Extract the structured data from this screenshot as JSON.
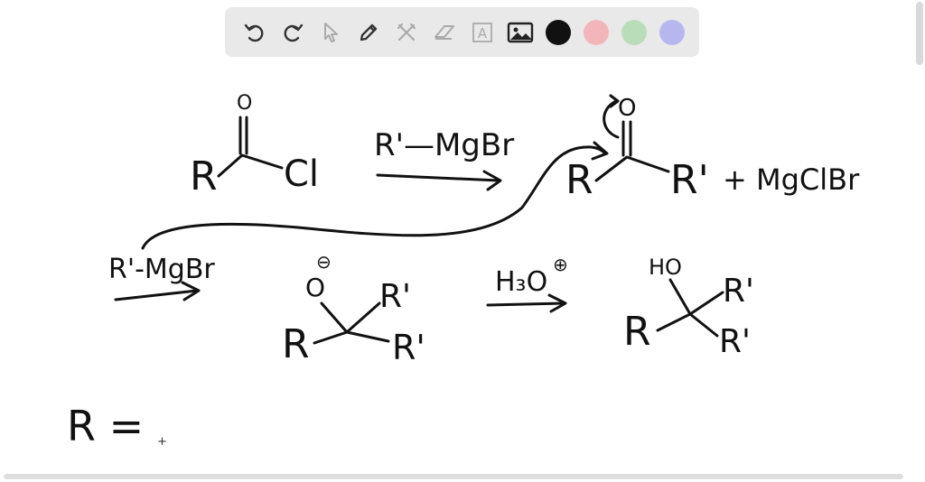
{
  "toolbar": {
    "tools": [
      {
        "name": "undo-icon"
      },
      {
        "name": "redo-icon"
      },
      {
        "name": "select-pointer-icon"
      },
      {
        "name": "pen-icon"
      },
      {
        "name": "tools-icon"
      },
      {
        "name": "eraser-icon"
      },
      {
        "name": "text-icon",
        "glyph": "A"
      },
      {
        "name": "image-icon"
      }
    ],
    "colors": [
      "#111111",
      "#f2b6ba",
      "#b9ddb8",
      "#b7b6ef"
    ]
  },
  "whiteboard": {
    "reaction1": {
      "reactant": {
        "carbonyl_o": "O",
        "r": "R",
        "leaving": "Cl"
      },
      "reagent": "R'—MgBr",
      "product": {
        "carbonyl_o": "O",
        "r": "R",
        "r_prime": "R'",
        "byproduct": "+ MgClBr"
      }
    },
    "reaction2": {
      "reagent": "R'-MgBr",
      "intermediate": {
        "oxide": "O",
        "charge": "⊖",
        "r": "R",
        "r1": "R'",
        "r2": "R'"
      }
    },
    "reaction3": {
      "reagent": "H₃O",
      "reagent_charge": "⊕",
      "product": {
        "hydroxyl": "HO",
        "r": "R",
        "r1": "R'",
        "r2": "R'"
      }
    },
    "note": "R ="
  }
}
